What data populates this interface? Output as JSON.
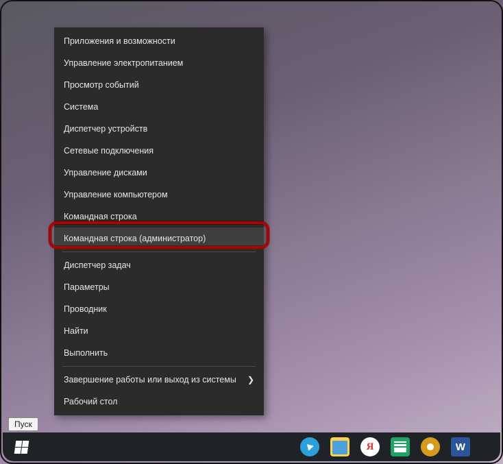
{
  "menu": {
    "items": [
      "Приложения и возможности",
      "Управление электропитанием",
      "Просмотр событий",
      "Система",
      "Диспетчер устройств",
      "Сетевые подключения",
      "Управление дисками",
      "Управление компьютером",
      "Командная строка",
      "Командная строка (администратор)"
    ],
    "items2": [
      "Диспетчер задач",
      "Параметры",
      "Проводник",
      "Найти",
      "Выполнить"
    ],
    "items3": [
      "Завершение работы или выход из системы",
      "Рабочий стол"
    ],
    "highlighted_index": 9
  },
  "tooltip": {
    "start": "Пуск"
  },
  "taskbar": {
    "icons": [
      {
        "name": "telegram-icon",
        "glyph": ""
      },
      {
        "name": "file-explorer-icon",
        "glyph": ""
      },
      {
        "name": "yandex-icon",
        "glyph": "Я"
      },
      {
        "name": "sheets-icon",
        "glyph": ""
      },
      {
        "name": "tips-icon",
        "glyph": ""
      },
      {
        "name": "word-icon",
        "glyph": "W"
      }
    ]
  }
}
